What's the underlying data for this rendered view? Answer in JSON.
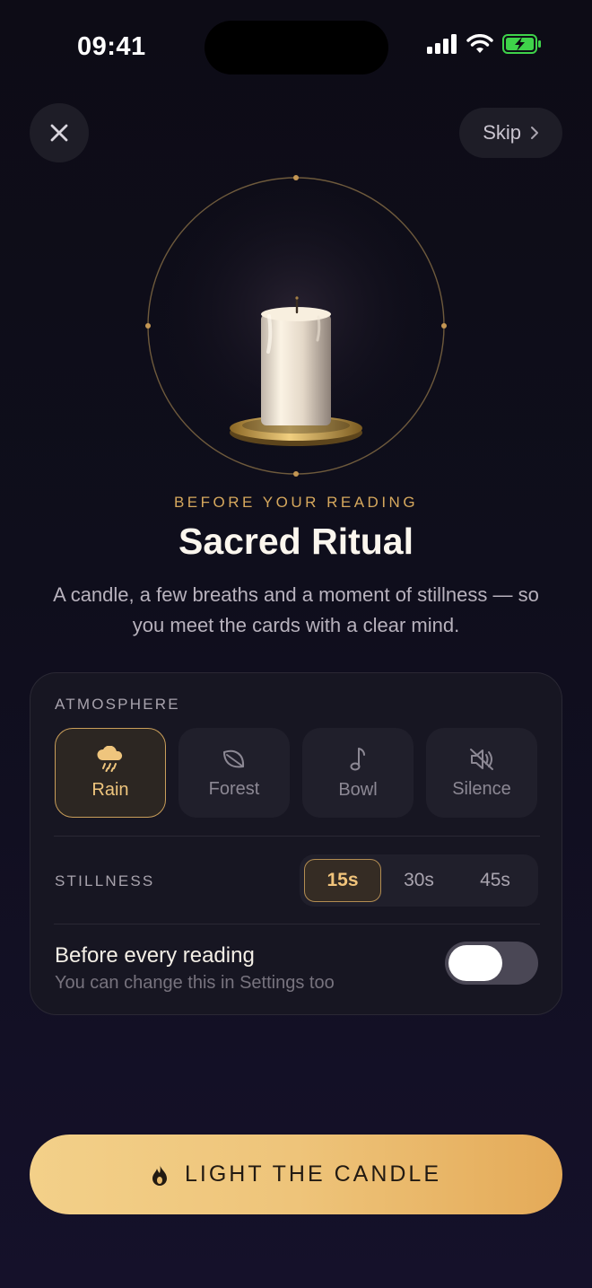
{
  "status_bar": {
    "time": "09:41"
  },
  "header": {
    "close_icon": "close-icon",
    "skip_label": "Skip"
  },
  "hero": {
    "kicker": "BEFORE YOUR READING",
    "title": "Sacred Ritual",
    "subtitle": "A candle, a few breaths and a moment of stillness — so you meet the cards with a clear mind."
  },
  "settings": {
    "atmosphere_label": "ATMOSPHERE",
    "atmospheres": [
      {
        "label": "Rain",
        "icon": "rain-cloud-icon",
        "selected": true
      },
      {
        "label": "Forest",
        "icon": "leaf-icon",
        "selected": false
      },
      {
        "label": "Bowl",
        "icon": "music-note-icon",
        "selected": false
      },
      {
        "label": "Silence",
        "icon": "muted-speaker-icon",
        "selected": false
      }
    ],
    "stillness_label": "STILLNESS",
    "durations": [
      {
        "label": "15s",
        "selected": true
      },
      {
        "label": "30s",
        "selected": false
      },
      {
        "label": "45s",
        "selected": false
      }
    ],
    "toggle_title": "Before every reading",
    "toggle_subtitle": "You can change this in Settings too",
    "toggle_on": false
  },
  "cta": {
    "label": "LIGHT THE CANDLE",
    "icon": "flame-icon"
  },
  "colors": {
    "accent": "#d6a85d",
    "background": "#0f0e1c",
    "panel": "#171622"
  }
}
